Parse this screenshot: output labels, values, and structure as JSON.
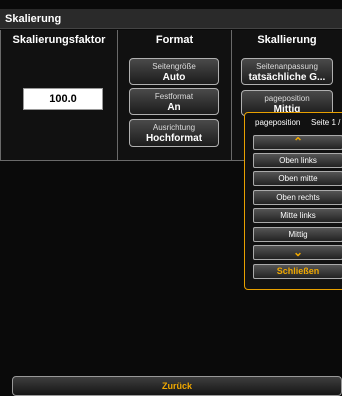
{
  "title": "Skalierung",
  "columns": {
    "scale": {
      "header": "Skalierungsfaktor",
      "value": "100.0"
    },
    "format": {
      "header": "Format",
      "buttons": [
        {
          "sub": "Seitengröße",
          "main": "Auto"
        },
        {
          "sub": "Festformat",
          "main": "An"
        },
        {
          "sub": "Ausrichtung",
          "main": "Hochformat"
        }
      ]
    },
    "scaling": {
      "header": "Skallierung",
      "buttons": [
        {
          "sub": "Seitenanpassung",
          "main": "tatsächliche G..."
        },
        {
          "sub": "pageposition",
          "main": "Mittig"
        }
      ]
    }
  },
  "popup": {
    "title": "pageposition",
    "page": "Seite 1 /",
    "up_arrow": "⌃",
    "down_arrow": "⌄",
    "options": [
      "Oben links",
      "Oben mitte",
      "Oben rechts",
      "Mitte links",
      "Mittig"
    ],
    "close": "Schließen"
  },
  "back": "Zurück",
  "colors": {
    "accent": "#f0a800",
    "background": "#0a0a0a"
  }
}
